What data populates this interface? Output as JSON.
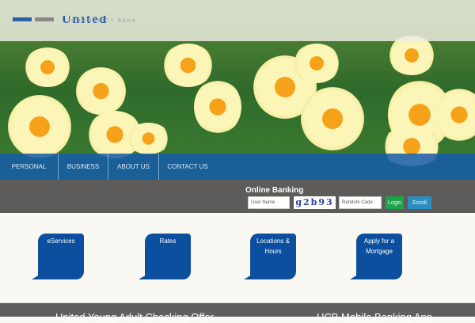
{
  "logo": {
    "name": "United",
    "sub": "COMMUNITY BANK"
  },
  "nav": [
    "PERSONAL",
    "BUSINESS",
    "ABOUT US",
    "CONTACT US"
  ],
  "online_banking": {
    "title": "Online Banking",
    "username_placeholder": "User Name",
    "captcha": "g2b93",
    "code_placeholder": "Random Code",
    "login": "Login",
    "enroll": "Enroll"
  },
  "tiles": [
    "eServices",
    "Rates",
    "Locations & Hours",
    "Apply for a Mortgage"
  ],
  "footer": [
    "United Young Adult Checking Offer",
    "UCB Mobile Banking App"
  ],
  "colors": {
    "brand": "#0b4f9e",
    "login": "#1fa34a",
    "enroll": "#2a8fc0"
  }
}
